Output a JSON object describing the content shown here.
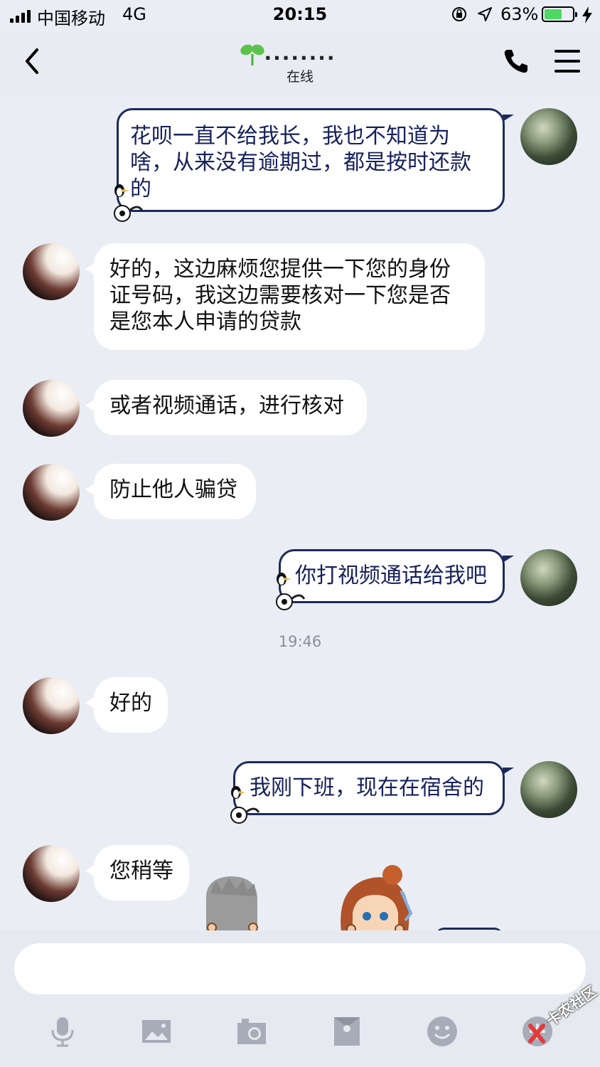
{
  "status": {
    "carrier": "中国移动",
    "network": "4G",
    "time": "20:15",
    "battery_pct": "63%",
    "battery_level": 0.63
  },
  "header": {
    "title": "........",
    "subtitle": "在线"
  },
  "messages": [
    {
      "side": "right",
      "text": "花呗一直不给我长，我也不知道为啥，从来没有逾期过，都是按时还款的"
    },
    {
      "side": "left",
      "text": "好的，这边麻烦您提供一下您的身份证号码，我这边需要核对一下您是否是您本人申请的贷款"
    },
    {
      "side": "left",
      "text": "或者视频通话，进行核对"
    },
    {
      "side": "left",
      "text": "防止他人骗贷"
    },
    {
      "side": "right",
      "text": "你打视频通话给我吧"
    },
    {
      "side": "left",
      "text": "好的"
    },
    {
      "side": "right",
      "text": "我刚下班，现在在宿舍的"
    },
    {
      "side": "left",
      "text": "您稍等"
    }
  ],
  "timestamp": "19:46",
  "watermark": "卡农社区",
  "colors": {
    "background": "#eaedf4",
    "right_bubble_border": "#1d2a5a",
    "battery": "#4cd964",
    "toolbar_icon": "#a7acb8"
  },
  "toolbar_icons": [
    "mic-icon",
    "image-icon",
    "camera-icon",
    "red-packet-icon",
    "emoji-icon",
    "plus-icon"
  ]
}
